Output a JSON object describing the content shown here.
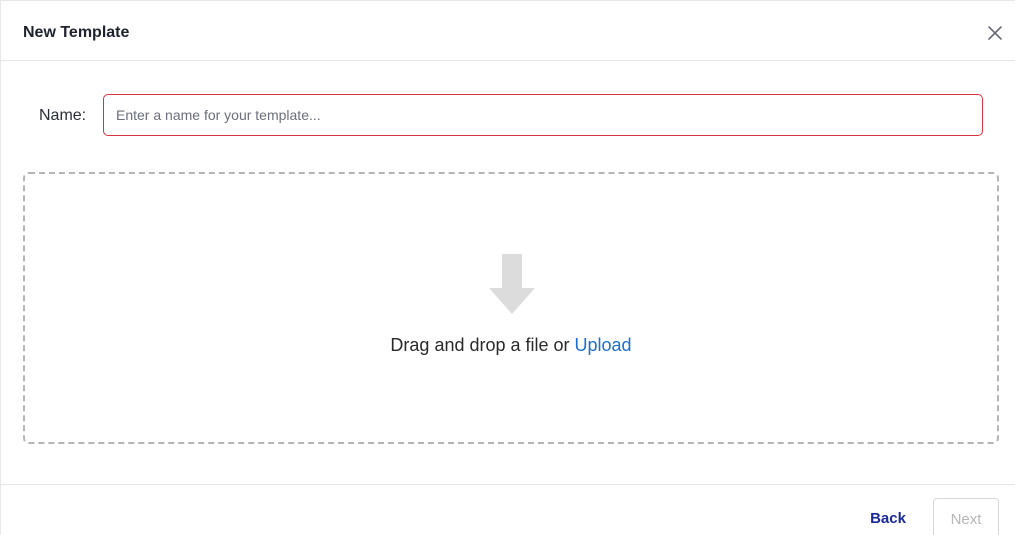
{
  "dialog": {
    "title": "New Template",
    "close_icon": "close-icon"
  },
  "form": {
    "name_label": "Name:",
    "name_placeholder": "Enter a name for your template...",
    "name_value": ""
  },
  "dropzone": {
    "icon": "arrow-down-icon",
    "text": "Drag and drop a file or ",
    "upload_label": "Upload"
  },
  "footer": {
    "back_label": "Back",
    "next_label": "Next"
  },
  "colors": {
    "error_border": "#d9333f",
    "link": "#1a6fd0",
    "back_text": "#1a2a9c",
    "disabled_text": "#b7b7b7"
  }
}
